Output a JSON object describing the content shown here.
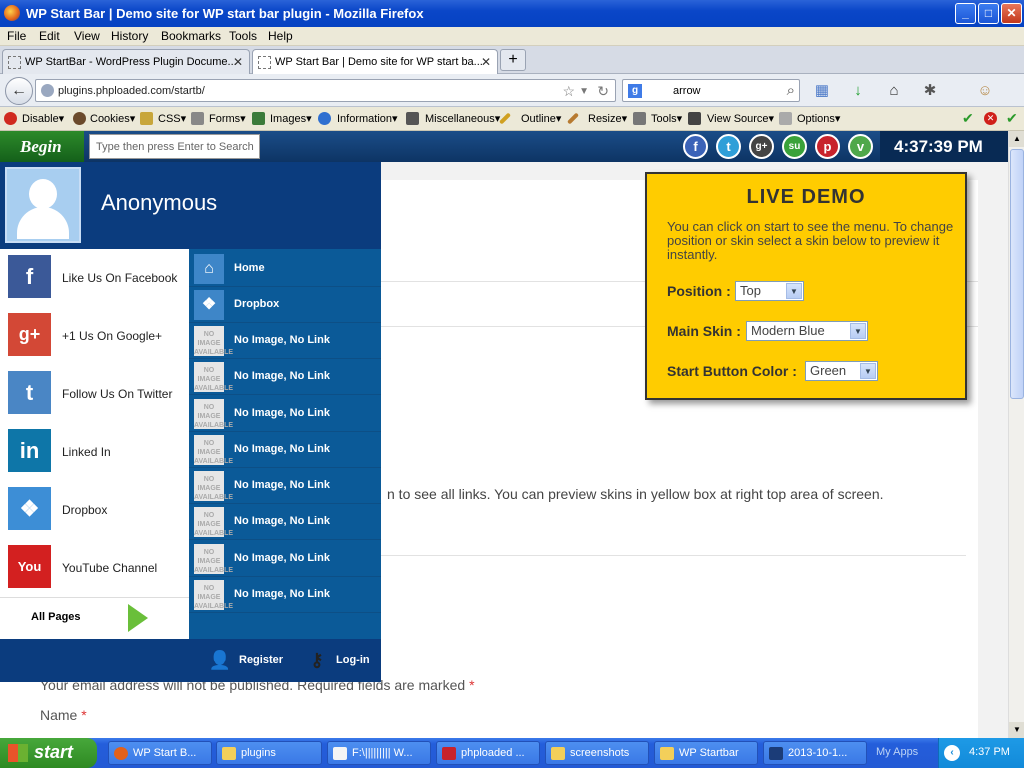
{
  "window": {
    "title": "WP Start Bar | Demo site for WP start bar plugin - Mozilla Firefox",
    "min": "_",
    "max": "□",
    "close": "✕"
  },
  "menubar": [
    "File",
    "Edit",
    "View",
    "History",
    "Bookmarks",
    "Tools",
    "Help"
  ],
  "tabs": [
    {
      "label": "WP StartBar - WordPress Plugin Docume...",
      "close": "✕"
    },
    {
      "label": "WP Start Bar | Demo site for WP start ba...",
      "close": "✕"
    }
  ],
  "newtab": "+",
  "nav": {
    "back": "←",
    "url": "plugins.phploaded.com/startb/",
    "search_engine": "g",
    "search_value": "arrow"
  },
  "devbar": [
    "Disable▾",
    "Cookies▾",
    "CSS▾",
    "Forms▾",
    "Images▾",
    "Information▾",
    "Miscellaneous▾",
    "Outline▾",
    "Resize▾",
    "Tools▾",
    "View Source▾",
    "Options▾"
  ],
  "startbar": {
    "begin": "Begin",
    "search_placeholder": "Type then press Enter to Search",
    "social": [
      {
        "name": "facebook",
        "glyph": "f",
        "color": "#3b63b8"
      },
      {
        "name": "twitter",
        "glyph": "t",
        "color": "#2f9fd8"
      },
      {
        "name": "googleplus",
        "glyph": "g+",
        "color": "#444"
      },
      {
        "name": "stumbleupon",
        "glyph": "su",
        "color": "#3aa23a"
      },
      {
        "name": "pinterest",
        "glyph": "p",
        "color": "#c8232c"
      },
      {
        "name": "vimeo",
        "glyph": "v",
        "color": "#4fa84a"
      }
    ],
    "clock": "4:37:39 PM"
  },
  "menu": {
    "username": "Anonymous",
    "left_items": [
      {
        "label": "Like Us On Facebook",
        "glyph": "f",
        "color": "#3b5998",
        "icon": "facebook-icon"
      },
      {
        "label": "+1 Us On Google+",
        "glyph": "g+",
        "color": "#d34836",
        "icon": "googleplus-icon"
      },
      {
        "label": "Follow Us On Twitter",
        "glyph": "t",
        "color": "#4a86c5",
        "icon": "twitter-icon"
      },
      {
        "label": "Linked In",
        "glyph": "in",
        "color": "#0e76a8",
        "icon": "linkedin-icon"
      },
      {
        "label": "Dropbox",
        "glyph": "❖",
        "color": "#3d8ed6",
        "icon": "dropbox-icon"
      },
      {
        "label": "YouTube Channel",
        "glyph": "You",
        "color": "#d32020",
        "icon": "youtube-icon"
      }
    ],
    "all_pages": "All Pages",
    "right_items": [
      "Home",
      "Dropbox",
      "No Image, No Link",
      "No Image, No Link",
      "No Image, No Link",
      "No Image, No Link",
      "No Image, No Link",
      "No Image, No Link",
      "No Image, No Link",
      "No Image, No Link"
    ],
    "noimage_text": "NO IMAGE AVAILABLE",
    "register": "Register",
    "login": "Log-in"
  },
  "demo": {
    "title": "LIVE DEMO",
    "desc": "You can click on start to see the menu. To change position or skin select a skin below to preview it instantly.",
    "position_label": "Position :",
    "position_value": "Top",
    "skin_label": "Main Skin :",
    "skin_value": "Modern Blue",
    "button_label": "Start Button Color :",
    "button_value": "Green"
  },
  "content": {
    "paragraph": "n to see all links. You can preview skins in yellow box at right top area of screen.",
    "email_note": "Your email address will not be published. Required fields are marked",
    "required": "*",
    "name_label": "Name",
    "name_required": "*"
  },
  "taskbar": {
    "start": "start",
    "tasks": [
      {
        "label": "WP Start B...",
        "color": "#e2611a"
      },
      {
        "label": "plugins",
        "color": "#f3cf5a"
      },
      {
        "label": "F:\\||||||||| W...",
        "color": "#f5f5f5"
      },
      {
        "label": "phploaded ...",
        "color": "#c8232c"
      },
      {
        "label": "screenshots",
        "color": "#f3cf5a"
      },
      {
        "label": "WP Startbar",
        "color": "#f3cf5a"
      },
      {
        "label": "2013-10-1...",
        "color": "#1b3c78"
      }
    ],
    "myapps": "My Apps",
    "time": "4:37 PM"
  }
}
